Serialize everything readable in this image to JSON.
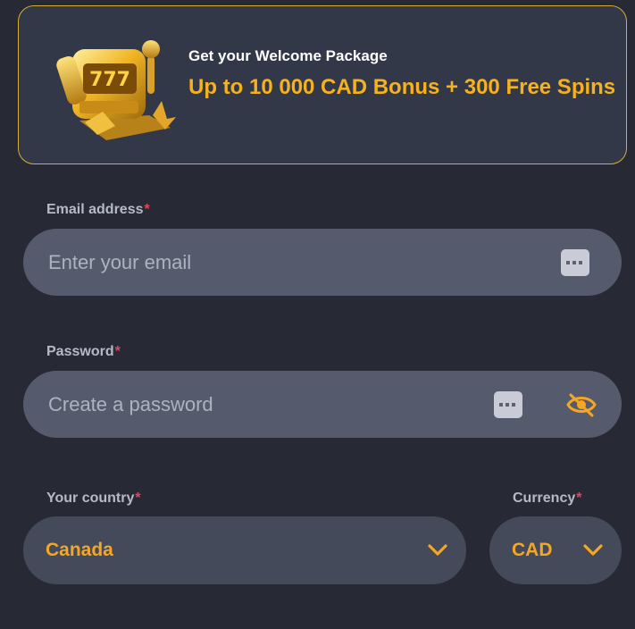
{
  "banner": {
    "pretitle": "Get your Welcome Package",
    "headline": "Up to 10 000 CAD Bonus + 300 Free Spins",
    "slot_text": "777"
  },
  "email": {
    "label": "Email address",
    "required_mark": "*",
    "placeholder": "Enter your email"
  },
  "password": {
    "label": "Password",
    "required_mark": "*",
    "placeholder": "Create a password"
  },
  "country": {
    "label": "Your country",
    "required_mark": "*",
    "value": "Canada"
  },
  "currency": {
    "label": "Currency",
    "required_mark": "*",
    "value": "CAD"
  },
  "colors": {
    "background": "#272a35",
    "banner_bg": "#333848",
    "accent_gold": "#f5b21e",
    "select_text": "#f5a623",
    "required": "#e8455a",
    "input_bg": "#555b6c"
  },
  "icons": {
    "banner": "slot-machine-icon",
    "autofill": "keyboard-autofill-icon",
    "password_toggle": "eye-slash-icon",
    "dropdown": "chevron-down-icon"
  }
}
